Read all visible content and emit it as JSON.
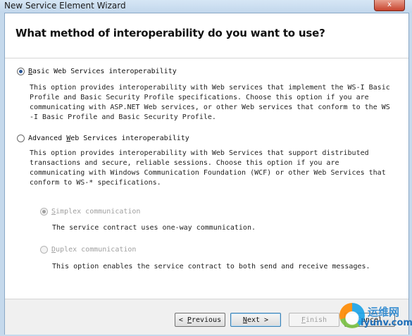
{
  "window": {
    "title": "New Service Element Wizard",
    "close_label": "x"
  },
  "header": {
    "question": "What method of interoperability do you want to use?"
  },
  "options": {
    "basic": {
      "access_key": "B",
      "label_rest": "asic Web Services interoperability",
      "selected": true,
      "description": "This option provides interoperability with Web services that implement the WS-I Basic\nProfile and Basic Security Profile specifications. Choose this option if you are\ncommunicating with ASP.NET Web services, or other Web services that conform to the WS\n-I Basic Profile and Basic Security Profile."
    },
    "advanced": {
      "label_before": "Advanced ",
      "access_key": "W",
      "label_rest": "eb Services interoperability",
      "selected": false,
      "description": "This option provides interoperability with Web Services that support distributed\ntransactions and secure, reliable sessions. Choose this option if you are\ncommunicating with Windows Communication Foundation (WCF) or other Web Services that\nconform to WS-* specifications."
    },
    "simplex": {
      "access_key": "S",
      "label_rest": "implex communication",
      "selected": true,
      "enabled": false,
      "description": "The service contract uses one-way communication."
    },
    "duplex": {
      "access_key": "D",
      "label_rest": "uplex communication",
      "selected": false,
      "enabled": false,
      "description": "This option enables the service contract to both send and receive messages."
    }
  },
  "buttons": {
    "previous": {
      "prefix": "< ",
      "access_key": "P",
      "rest": "revious",
      "enabled": true
    },
    "next": {
      "access_key": "N",
      "rest": "ext",
      "suffix": " >",
      "enabled": true,
      "focused": true
    },
    "finish": {
      "access_key": "F",
      "rest": "inish",
      "enabled": false
    },
    "cancel": {
      "label": "Cancel",
      "enabled": true
    }
  },
  "watermark": {
    "cn_text": "运维网",
    "url": "iyunv.com"
  },
  "colors": {
    "accent": "#2b5797",
    "disabled_text": "#a0a0a0",
    "window_frame": "#c5d9ec"
  }
}
